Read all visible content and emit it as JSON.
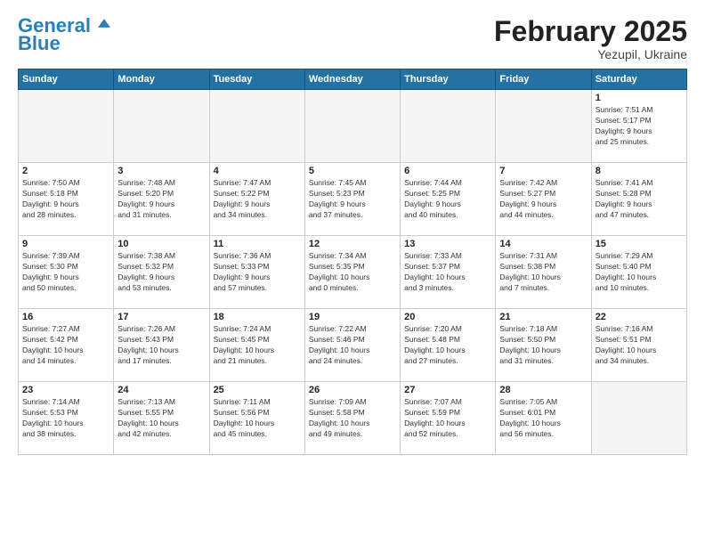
{
  "logo": {
    "text1": "General",
    "text2": "Blue"
  },
  "title": "February 2025",
  "subtitle": "Yezupil, Ukraine",
  "days_header": [
    "Sunday",
    "Monday",
    "Tuesday",
    "Wednesday",
    "Thursday",
    "Friday",
    "Saturday"
  ],
  "weeks": [
    [
      {
        "num": "",
        "info": ""
      },
      {
        "num": "",
        "info": ""
      },
      {
        "num": "",
        "info": ""
      },
      {
        "num": "",
        "info": ""
      },
      {
        "num": "",
        "info": ""
      },
      {
        "num": "",
        "info": ""
      },
      {
        "num": "1",
        "info": "Sunrise: 7:51 AM\nSunset: 5:17 PM\nDaylight: 9 hours\nand 25 minutes."
      }
    ],
    [
      {
        "num": "2",
        "info": "Sunrise: 7:50 AM\nSunset: 5:18 PM\nDaylight: 9 hours\nand 28 minutes."
      },
      {
        "num": "3",
        "info": "Sunrise: 7:48 AM\nSunset: 5:20 PM\nDaylight: 9 hours\nand 31 minutes."
      },
      {
        "num": "4",
        "info": "Sunrise: 7:47 AM\nSunset: 5:22 PM\nDaylight: 9 hours\nand 34 minutes."
      },
      {
        "num": "5",
        "info": "Sunrise: 7:45 AM\nSunset: 5:23 PM\nDaylight: 9 hours\nand 37 minutes."
      },
      {
        "num": "6",
        "info": "Sunrise: 7:44 AM\nSunset: 5:25 PM\nDaylight: 9 hours\nand 40 minutes."
      },
      {
        "num": "7",
        "info": "Sunrise: 7:42 AM\nSunset: 5:27 PM\nDaylight: 9 hours\nand 44 minutes."
      },
      {
        "num": "8",
        "info": "Sunrise: 7:41 AM\nSunset: 5:28 PM\nDaylight: 9 hours\nand 47 minutes."
      }
    ],
    [
      {
        "num": "9",
        "info": "Sunrise: 7:39 AM\nSunset: 5:30 PM\nDaylight: 9 hours\nand 50 minutes."
      },
      {
        "num": "10",
        "info": "Sunrise: 7:38 AM\nSunset: 5:32 PM\nDaylight: 9 hours\nand 53 minutes."
      },
      {
        "num": "11",
        "info": "Sunrise: 7:36 AM\nSunset: 5:33 PM\nDaylight: 9 hours\nand 57 minutes."
      },
      {
        "num": "12",
        "info": "Sunrise: 7:34 AM\nSunset: 5:35 PM\nDaylight: 10 hours\nand 0 minutes."
      },
      {
        "num": "13",
        "info": "Sunrise: 7:33 AM\nSunset: 5:37 PM\nDaylight: 10 hours\nand 3 minutes."
      },
      {
        "num": "14",
        "info": "Sunrise: 7:31 AM\nSunset: 5:38 PM\nDaylight: 10 hours\nand 7 minutes."
      },
      {
        "num": "15",
        "info": "Sunrise: 7:29 AM\nSunset: 5:40 PM\nDaylight: 10 hours\nand 10 minutes."
      }
    ],
    [
      {
        "num": "16",
        "info": "Sunrise: 7:27 AM\nSunset: 5:42 PM\nDaylight: 10 hours\nand 14 minutes."
      },
      {
        "num": "17",
        "info": "Sunrise: 7:26 AM\nSunset: 5:43 PM\nDaylight: 10 hours\nand 17 minutes."
      },
      {
        "num": "18",
        "info": "Sunrise: 7:24 AM\nSunset: 5:45 PM\nDaylight: 10 hours\nand 21 minutes."
      },
      {
        "num": "19",
        "info": "Sunrise: 7:22 AM\nSunset: 5:46 PM\nDaylight: 10 hours\nand 24 minutes."
      },
      {
        "num": "20",
        "info": "Sunrise: 7:20 AM\nSunset: 5:48 PM\nDaylight: 10 hours\nand 27 minutes."
      },
      {
        "num": "21",
        "info": "Sunrise: 7:18 AM\nSunset: 5:50 PM\nDaylight: 10 hours\nand 31 minutes."
      },
      {
        "num": "22",
        "info": "Sunrise: 7:16 AM\nSunset: 5:51 PM\nDaylight: 10 hours\nand 34 minutes."
      }
    ],
    [
      {
        "num": "23",
        "info": "Sunrise: 7:14 AM\nSunset: 5:53 PM\nDaylight: 10 hours\nand 38 minutes."
      },
      {
        "num": "24",
        "info": "Sunrise: 7:13 AM\nSunset: 5:55 PM\nDaylight: 10 hours\nand 42 minutes."
      },
      {
        "num": "25",
        "info": "Sunrise: 7:11 AM\nSunset: 5:56 PM\nDaylight: 10 hours\nand 45 minutes."
      },
      {
        "num": "26",
        "info": "Sunrise: 7:09 AM\nSunset: 5:58 PM\nDaylight: 10 hours\nand 49 minutes."
      },
      {
        "num": "27",
        "info": "Sunrise: 7:07 AM\nSunset: 5:59 PM\nDaylight: 10 hours\nand 52 minutes."
      },
      {
        "num": "28",
        "info": "Sunrise: 7:05 AM\nSunset: 6:01 PM\nDaylight: 10 hours\nand 56 minutes."
      },
      {
        "num": "",
        "info": ""
      }
    ]
  ]
}
